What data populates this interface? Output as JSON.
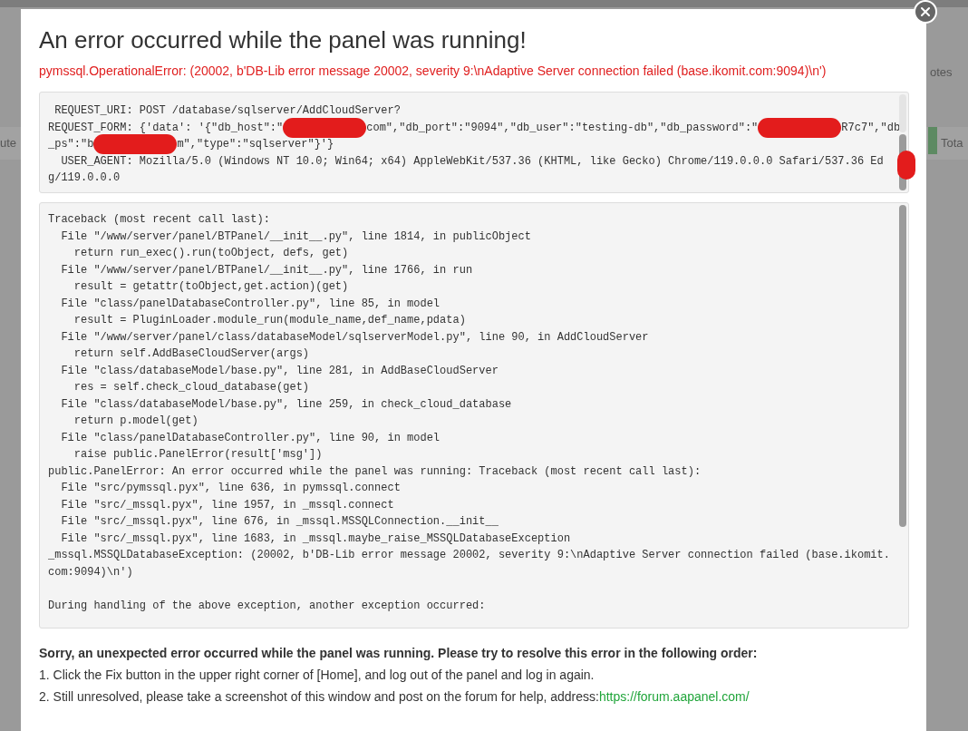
{
  "background_labels": [
    {
      "kind": "left",
      "text": "ute"
    },
    {
      "kind": "right-top",
      "text": "otes"
    },
    {
      "kind": "right-bottom",
      "text": "Tota"
    }
  ],
  "dialog": {
    "title": "An error occurred while the panel was running!",
    "error_message": "pymssql.OperationalError: (20002, b'DB-Lib error message 20002, severity 9:\\nAdaptive Server connection failed (base.ikomit.com:9094)\\n')",
    "request_lines": [
      [
        {
          "kind": "text",
          "text": " REQUEST_URI: POST /database/sqlserver/AddCloudServer?"
        }
      ],
      [
        {
          "kind": "text",
          "text": "REQUEST_FORM: {'data': '{\"db_host\":\""
        },
        {
          "kind": "redaction",
          "color": "#e31c1c"
        },
        {
          "kind": "text",
          "text": "com\",\"db_port\":\"9094\",\"db_user\":\"testing-db\",\"db_password\":\""
        },
        {
          "kind": "redaction",
          "color": "#e31c1c"
        },
        {
          "kind": "text",
          "text": "R7c7\",\"db"
        }
      ],
      [
        {
          "kind": "text",
          "text": "_ps\":\"b"
        },
        {
          "kind": "redaction",
          "color": "#e31c1c"
        },
        {
          "kind": "text",
          "text": "m\",\"type\":\"sqlserver\"}'}"
        }
      ],
      [
        {
          "kind": "text",
          "text": "  USER_AGENT: Mozilla/5.0 (Windows NT 10.0; Win64; x64) AppleWebKit/537.36 (KHTML, like Gecko) Chrome/119.0.0.0 Safari/537.36 Ed"
        }
      ],
      [
        {
          "kind": "text",
          "text": "g/119.0.0.0"
        }
      ]
    ],
    "scrollbar_redacted": true,
    "traceback_lines": [
      {
        "text": "Traceback (most recent call last):"
      },
      {
        "text": "  File \"/www/server/panel/BTPanel/__init__.py\", line 1814, in publicObject"
      },
      {
        "text": "    return run_exec().run(toObject, defs, get)"
      },
      {
        "text": "  File \"/www/server/panel/BTPanel/__init__.py\", line 1766, in run"
      },
      {
        "text": "    result = getattr(toObject,get.action)(get)"
      },
      {
        "text": "  File \"class/panelDatabaseController.py\", line 85, in model"
      },
      {
        "text": "    result = PluginLoader.module_run(module_name,def_name,pdata)"
      },
      {
        "text": "  File \"/www/server/panel/class/databaseModel/sqlserverModel.py\", line 90, in AddCloudServer"
      },
      {
        "text": "    return self.AddBaseCloudServer(args)"
      },
      {
        "text": "  File \"class/databaseModel/base.py\", line 281, in AddBaseCloudServer"
      },
      {
        "text": "    res = self.check_cloud_database(get)"
      },
      {
        "text": "  File \"class/databaseModel/base.py\", line 259, in check_cloud_database"
      },
      {
        "text": "    return p.model(get)"
      },
      {
        "text": "  File \"class/panelDatabaseController.py\", line 90, in model"
      },
      {
        "text": "    raise public.PanelError(result['msg'])"
      },
      {
        "text": "public.PanelError: An error occurred while the panel was running: Traceback (most recent call last):"
      },
      {
        "text": "  File \"src/pymssql.pyx\", line 636, in pymssql.connect"
      },
      {
        "text": "  File \"src/_mssql.pyx\", line 1957, in _mssql.connect"
      },
      {
        "text": "  File \"src/_mssql.pyx\", line 676, in _mssql.MSSQLConnection.__init__"
      },
      {
        "text": "  File \"src/_mssql.pyx\", line 1683, in _mssql.maybe_raise_MSSQLDatabaseException"
      },
      {
        "text": "_mssql.MSSQLDatabaseException: (20002, b'DB-Lib error message 20002, severity 9:\\nAdaptive Server connection failed (base.ikomit."
      },
      {
        "text": "com:9094)\\n')"
      },
      {
        "text": "During handling of the above exception, another exception occurred:",
        "blank_before": true
      }
    ],
    "help": {
      "heading": "Sorry, an unexpected error occurred while the panel was running. Please try to resolve this error in the following order:",
      "steps": [
        {
          "text": "1. Click the Fix button in the upper right corner of [Home], and log out of the panel and log in again."
        },
        {
          "text": "2. Still unresolved, please take a screenshot of this window and post on the forum for help, address:",
          "link": "https://forum.aapanel.com/"
        }
      ]
    }
  }
}
